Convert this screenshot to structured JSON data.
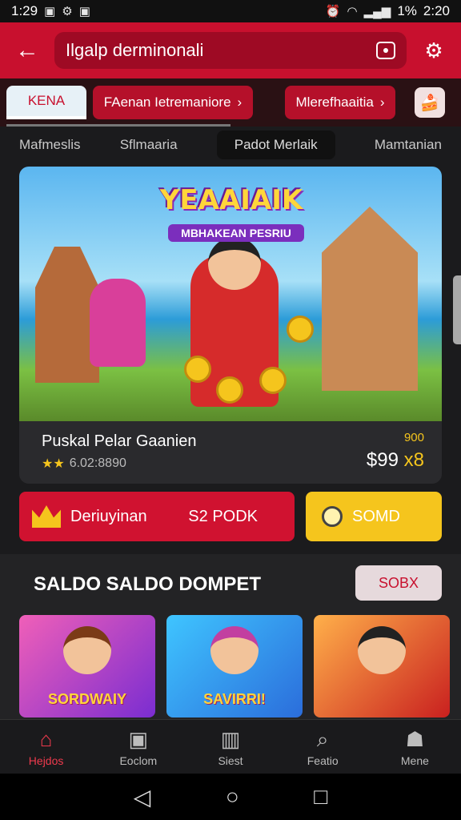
{
  "status_bar": {
    "left_time": "1:29",
    "right_time": "2:20",
    "battery": "1%"
  },
  "header": {
    "search_text": "Ilgalp derminonali"
  },
  "category_chips": [
    {
      "label": "KENA"
    },
    {
      "label": "FAenan Ietremaniore"
    },
    {
      "label": "Mlerefhaaitia"
    }
  ],
  "sub_tabs": [
    {
      "label": "Mafmeslis"
    },
    {
      "label": "Sflmaaria"
    },
    {
      "label": "Padot Merlaik"
    },
    {
      "label": "Mamtanian"
    }
  ],
  "hero": {
    "title": "YEAAIAIK",
    "subtitle": "MBHAKEAN PESRIU",
    "game_name": "Puskal Pelar Gaanien",
    "stars": "★★",
    "rating_text": "6.02:8890",
    "price_small": "900",
    "price_big": "$99",
    "multiplier": "x8"
  },
  "actions": {
    "primary_label": "Deriuyinan",
    "primary_value": "S2 PODK",
    "secondary_label": "SOMD"
  },
  "section": {
    "title": "SALDO SALDO DOMPET",
    "button_label": "SOBX"
  },
  "games": [
    {
      "label": "SORDWAIY"
    },
    {
      "label": "SAVIRRI!"
    },
    {
      "label": ""
    }
  ],
  "bottom_nav": [
    {
      "label": "Hejdos",
      "icon": "home-icon"
    },
    {
      "label": "Eoclom",
      "icon": "inbox-icon"
    },
    {
      "label": "Siest",
      "icon": "chart-icon"
    },
    {
      "label": "Featio",
      "icon": "search-icon"
    },
    {
      "label": "Mene",
      "icon": "profile-icon"
    }
  ]
}
